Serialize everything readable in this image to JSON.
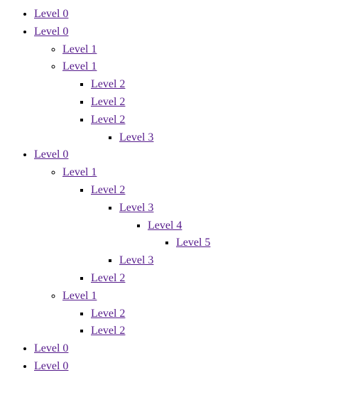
{
  "tree": [
    {
      "label": "Level 0"
    },
    {
      "label": "Level 0",
      "children": [
        {
          "label": "Level 1"
        },
        {
          "label": "Level 1",
          "children": [
            {
              "label": "Level 2"
            },
            {
              "label": "Level 2"
            },
            {
              "label": "Level 2",
              "children": [
                {
                  "label": "Level 3"
                }
              ]
            }
          ]
        }
      ]
    },
    {
      "label": "Level 0",
      "children": [
        {
          "label": "Level 1",
          "children": [
            {
              "label": "Level 2",
              "children": [
                {
                  "label": "Level 3",
                  "children": [
                    {
                      "label": "Level 4",
                      "children": [
                        {
                          "label": "Level 5"
                        }
                      ]
                    }
                  ]
                },
                {
                  "label": "Level 3"
                }
              ]
            },
            {
              "label": "Level 2"
            }
          ]
        },
        {
          "label": "Level 1",
          "children": [
            {
              "label": "Level 2"
            },
            {
              "label": "Level 2"
            }
          ]
        }
      ]
    },
    {
      "label": "Level 0"
    },
    {
      "label": "Level 0"
    }
  ]
}
